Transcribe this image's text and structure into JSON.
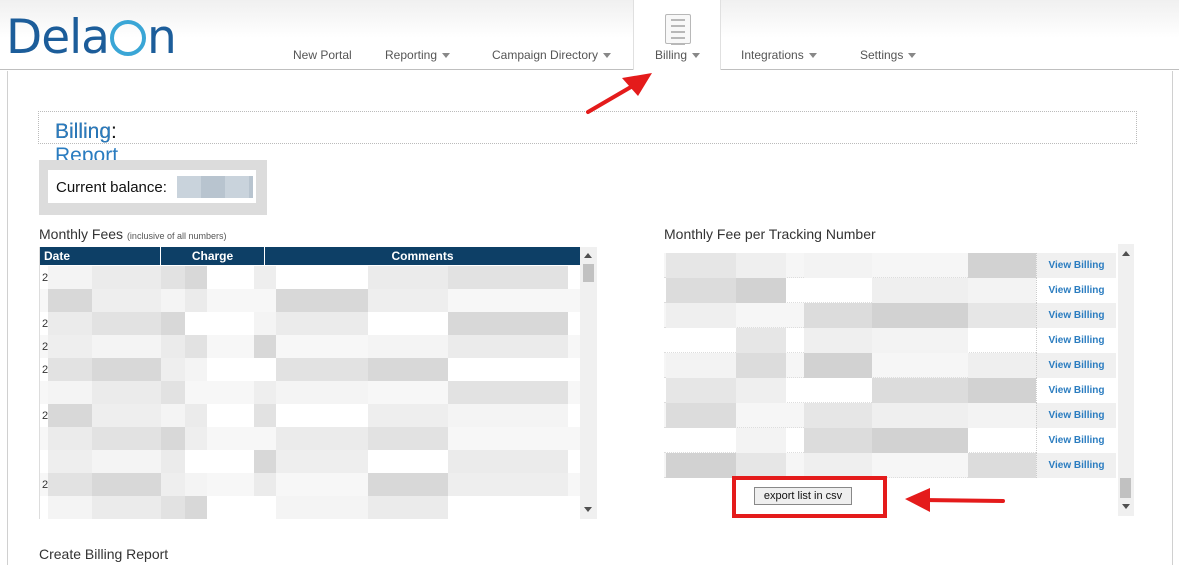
{
  "logo": {
    "text_before": "Dela",
    "text_after": "n"
  },
  "nav": {
    "items": [
      {
        "label": "New Portal",
        "caret": false
      },
      {
        "label": "Reporting",
        "caret": true
      },
      {
        "label": "Campaign Directory",
        "caret": true
      },
      {
        "label": "Billing",
        "caret": true,
        "active": true
      },
      {
        "label": "Integrations",
        "caret": true
      },
      {
        "label": "Settings",
        "caret": true
      }
    ],
    "active_icon": "document-icon"
  },
  "page": {
    "title_prefix": "Billing:",
    "title_main": "Billing Report",
    "balance_label": "Current balance:",
    "balance_value_redacted": true
  },
  "monthly_fees": {
    "heading": "Monthly Fees",
    "note": "(inclusive of all numbers)",
    "columns": [
      "Date",
      "Charge",
      "Comments"
    ],
    "row_prefixes": [
      "2",
      "",
      "2",
      "2",
      "2",
      "",
      "2",
      "",
      "",
      "2",
      ""
    ]
  },
  "tracking": {
    "heading": "Monthly Fee per Tracking Number",
    "row_action_label": "View Billing",
    "row_count": 9,
    "export_label": "export list in csv"
  },
  "create_report": {
    "heading": "Create Billing Report"
  },
  "colors": {
    "header_navy": "#0d3f66",
    "link_blue": "#2a7cc0",
    "annotation_red": "#e41b1b"
  }
}
